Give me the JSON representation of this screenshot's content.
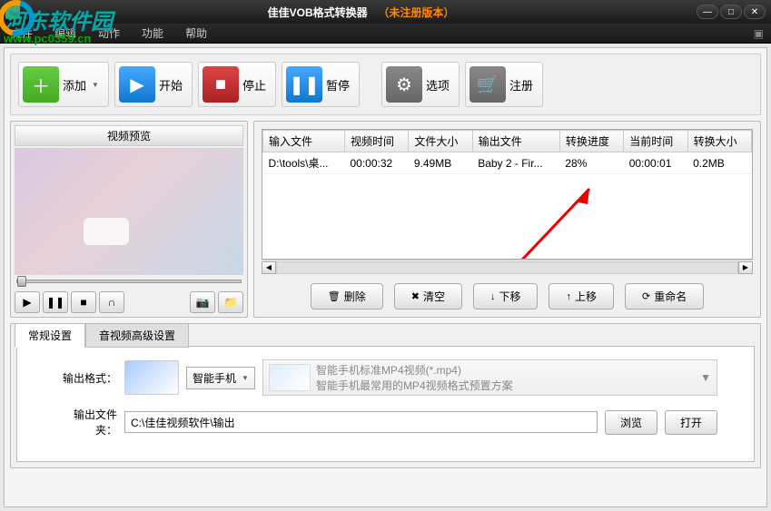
{
  "titlebar": {
    "title_main": "佳佳VOB格式转换器",
    "title_sub": "（未注册版本）"
  },
  "menu": {
    "file": "文件",
    "edit": "编辑",
    "action": "动作",
    "function": "功能",
    "help": "帮助"
  },
  "watermark": {
    "line1": "河东软件园",
    "line2": "www.pc0359.cn"
  },
  "toolbar": {
    "add": "添加",
    "start": "开始",
    "stop": "停止",
    "pause": "暂停",
    "options": "选项",
    "register": "注册"
  },
  "preview": {
    "title": "视频预览"
  },
  "table": {
    "headers": {
      "input_file": "输入文件",
      "video_time": "视频时间",
      "file_size": "文件大小",
      "output_file": "输出文件",
      "progress": "转换进度",
      "current_time": "当前时间",
      "convert_size": "转换大小"
    },
    "rows": [
      {
        "input_file": "D:\\tools\\桌...",
        "video_time": "00:00:32",
        "file_size": "9.49MB",
        "output_file": "Baby 2 - Fir...",
        "progress": "28%",
        "current_time": "00:00:01",
        "convert_size": "0.2MB"
      }
    ]
  },
  "actions": {
    "delete": "删除",
    "clear": "清空",
    "move_down": "下移",
    "move_up": "上移",
    "rename": "重命名"
  },
  "tabs": {
    "general": "常规设置",
    "advanced": "音视频高级设置"
  },
  "settings": {
    "format_label": "输出格式：",
    "device_name": "智能手机",
    "preset_title": "智能手机标准MP4视频(*.mp4)",
    "preset_desc": "智能手机最常用的MP4视频格式预置方案",
    "folder_label": "输出文件夹：",
    "folder_path": "C:\\佳佳视频软件\\输出",
    "browse": "浏览",
    "open": "打开"
  }
}
